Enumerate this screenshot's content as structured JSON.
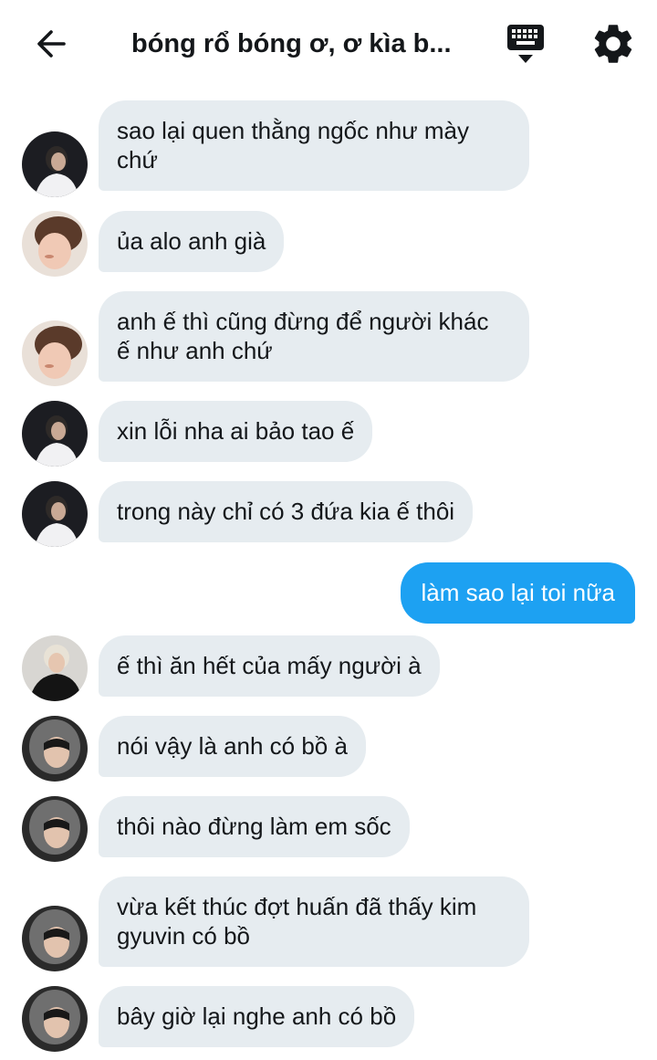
{
  "header": {
    "title": "bóng rổ bóng ơ, ơ kìa b...",
    "back_icon": "arrow-left-icon",
    "keyboard_icon": "keyboard-icon",
    "settings_icon": "gear-icon"
  },
  "colors": {
    "incoming_bubble": "#e6ecf0",
    "outgoing_bubble": "#1da1f2",
    "text": "#14171a"
  },
  "messages": [
    {
      "direction": "in",
      "avatar": "avatar-a",
      "text": "sao lại quen thằng ngốc như mày\nchứ"
    },
    {
      "direction": "in",
      "avatar": "avatar-b",
      "text": "ủa alo anh già"
    },
    {
      "direction": "in",
      "avatar": "avatar-b",
      "text": "anh ế thì cũng đừng để người khác\nế như anh chứ"
    },
    {
      "direction": "in",
      "avatar": "avatar-a",
      "text": "xin lỗi nha ai bảo tao ế"
    },
    {
      "direction": "in",
      "avatar": "avatar-a",
      "text": "trong này chỉ có 3 đứa kia ế thôi"
    },
    {
      "direction": "out",
      "text": "làm sao lại toi nữa"
    },
    {
      "direction": "in",
      "avatar": "avatar-c",
      "text": "ế thì ăn hết của mấy người à"
    },
    {
      "direction": "in",
      "avatar": "avatar-d",
      "text": "nói vậy là anh có bồ à"
    },
    {
      "direction": "in",
      "avatar": "avatar-d",
      "text": "thôi nào đừng làm em sốc"
    },
    {
      "direction": "in",
      "avatar": "avatar-d",
      "text": "vừa kết thúc đợt huấn đã thấy kim\ngyuvin có bồ"
    },
    {
      "direction": "in",
      "avatar": "avatar-d",
      "text": "bây giờ lại nghe anh có bồ"
    }
  ]
}
